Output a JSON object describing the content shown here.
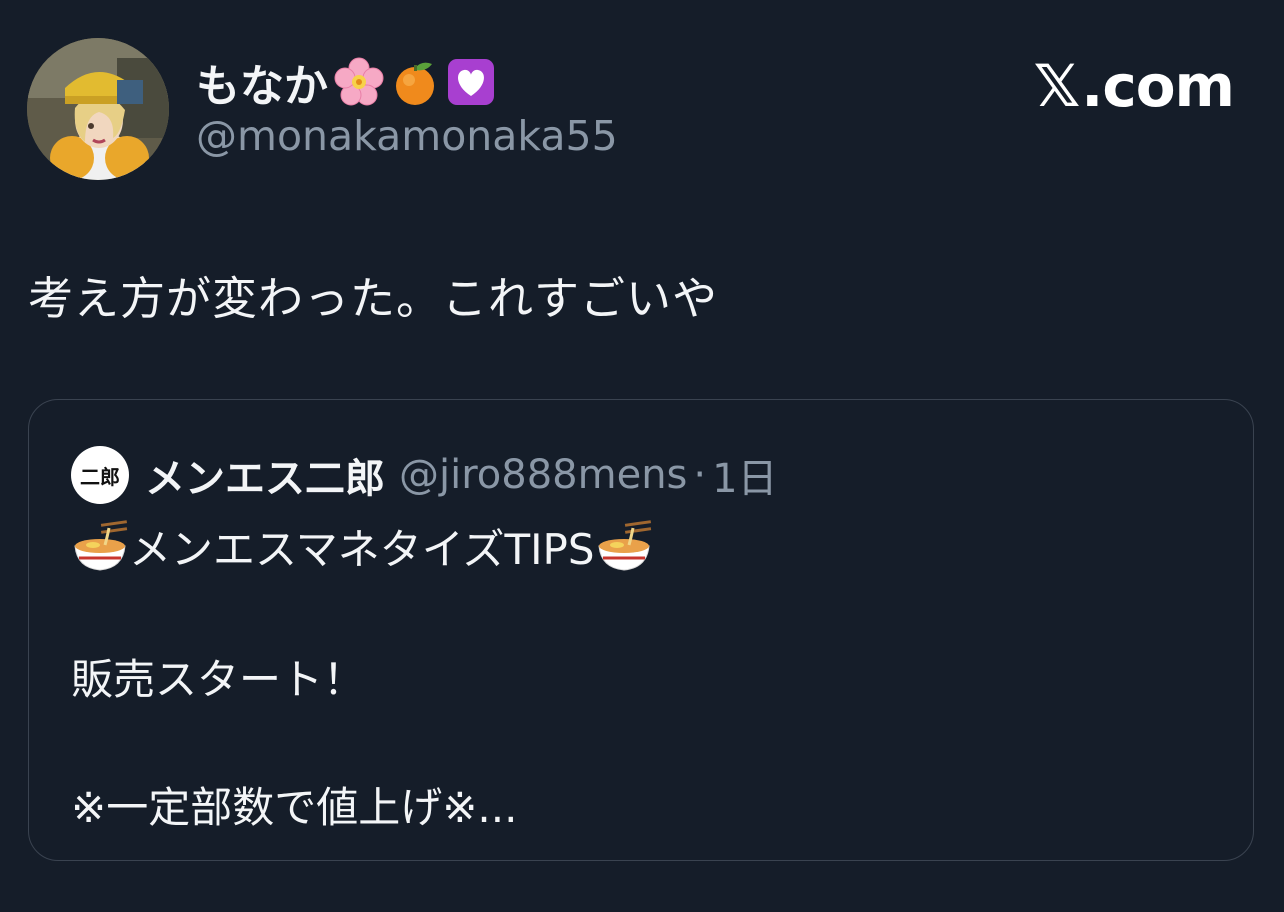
{
  "author": {
    "display_name": "もなか",
    "emojis": [
      "cherry-blossom",
      "tangerine",
      "purple-heart"
    ],
    "handle": "@monakamonaka55"
  },
  "brand": {
    "x_glyph": "𝕏",
    "domain": ".com"
  },
  "tweet": {
    "text": "考え方が変わった。これすごいや"
  },
  "quote": {
    "avatar_text": "二郎",
    "name": "メンエス二郎",
    "handle": "@jiro888mens",
    "separator": "·",
    "time": "1日",
    "line1": "メンエスマネタイズTIPS",
    "line2": "販売スタート！",
    "line3": "※一定部数で値上げ※..."
  },
  "colors": {
    "background": "#151d29",
    "text": "#f3f5f7",
    "muted": "#8a97a6",
    "border": "#3a4350"
  }
}
